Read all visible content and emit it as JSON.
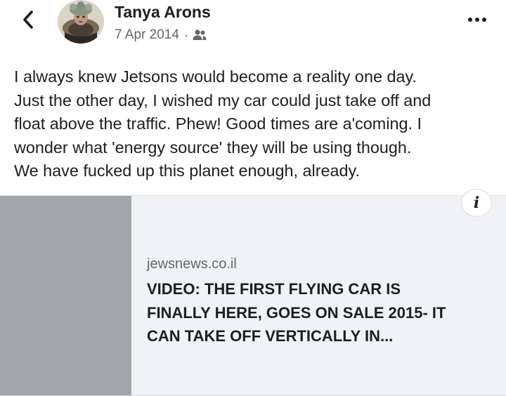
{
  "header": {
    "back_icon": "chevron-left-icon",
    "author_name": "Tanya Arons",
    "date": "7 Apr 2014",
    "separator": "·",
    "audience_icon": "friends-icon",
    "more_icon": "more-horizontal-icon"
  },
  "post": {
    "lines": [
      "I always knew Jetsons would become a reality one day.",
      "Just the other day, I wished my car could just take off and",
      "float above the traffic.  Phew!  Good times are a'coming.  I",
      "wonder what 'energy source' they will be using though.",
      "We have fucked up this planet enough, already."
    ]
  },
  "link_preview": {
    "info_label": "i",
    "domain": "jewsnews.co.il",
    "title_lines": [
      "VIDEO: THE FIRST FLYING CAR IS",
      "FINALLY HERE, GOES ON SALE 2015- IT",
      "CAN TAKE OFF VERTICALLY IN..."
    ]
  },
  "colors": {
    "text_primary": "#1c1e21",
    "text_secondary": "#65676b",
    "thumbnail": "#a3a6aa",
    "card_background": "#f0f2f5"
  }
}
